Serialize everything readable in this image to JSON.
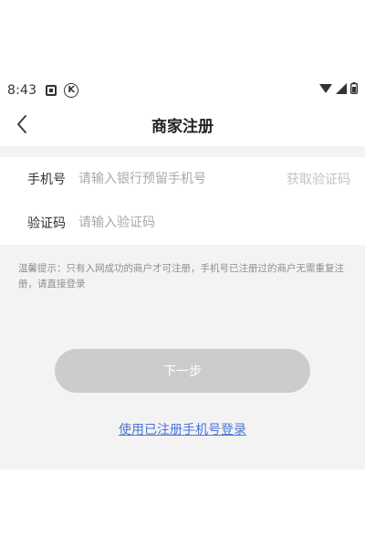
{
  "status_bar": {
    "time": "8:43",
    "icons": {
      "notification": "square-notification-icon",
      "k_badge": "k-circle-icon",
      "k_glyph": "K",
      "wifi": "wifi-icon",
      "signal": "signal-icon",
      "battery": "battery-icon"
    }
  },
  "header": {
    "back_icon": "chevron-left-icon",
    "title": "商家注册"
  },
  "form": {
    "phone": {
      "label": "手机号",
      "value": "",
      "placeholder": "请输入银行预留手机号",
      "get_code_label": "获取验证码"
    },
    "code": {
      "label": "验证码",
      "value": "",
      "placeholder": "请输入验证码"
    }
  },
  "tip": "温馨提示：只有入网成功的商户才可注册，手机号已注册过的商户无需重复注册，请直接登录",
  "next_button": "下一步",
  "login_link": "使用已注册手机号登录",
  "colors": {
    "accent_link": "#4a76d6",
    "button_disabled": "#cccccc",
    "background_gray": "#f3f3f3"
  }
}
